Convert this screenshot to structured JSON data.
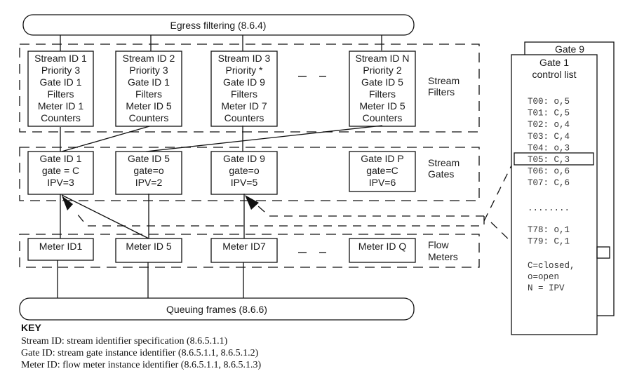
{
  "diagram": {
    "egress": {
      "label": "Egress filtering (8.6.4)"
    },
    "queuing": {
      "label": "Queuing frames (8.6.6)"
    },
    "groups": {
      "stream_filters": {
        "line1": "Stream",
        "line2": "Filters"
      },
      "stream_gates": {
        "line1": "Stream",
        "line2": "Gates"
      },
      "flow_meters": {
        "line1": "Flow",
        "line2": "Meters"
      }
    },
    "stream_filters": [
      {
        "lines": [
          "Stream ID 1",
          "Priority 3",
          "Gate ID 1",
          "Filters",
          "Meter ID 1",
          "Counters"
        ]
      },
      {
        "lines": [
          "Stream ID 2",
          "Priority 3",
          "Gate ID 1",
          "Filters",
          "Meter ID 5",
          "Counters"
        ]
      },
      {
        "lines": [
          "Stream ID 3",
          "Priority *",
          "Gate ID 9",
          "Filters",
          "Meter ID 7",
          "Counters"
        ]
      },
      {
        "lines": [
          "Stream ID N",
          "Priority 2",
          "Gate ID 5",
          "Filters",
          "Meter ID 5",
          "Counters"
        ]
      }
    ],
    "stream_gates": [
      {
        "lines": [
          "Gate ID 1",
          "gate = C",
          "IPV=3"
        ]
      },
      {
        "lines": [
          "Gate ID 5",
          "gate=o",
          "IPV=2"
        ]
      },
      {
        "lines": [
          "Gate ID 9",
          "gate=o",
          "IPV=5"
        ]
      },
      {
        "lines": [
          "Gate ID P",
          "gate=C",
          "IPV=6"
        ]
      }
    ],
    "flow_meters": [
      {
        "label": "Meter ID1"
      },
      {
        "label": "Meter ID 5"
      },
      {
        "label": "Meter ID7"
      },
      {
        "label": "Meter ID Q"
      }
    ],
    "control_list": {
      "back_title": "Gate 9",
      "title_line1": "Gate 1",
      "title_line2": "control list",
      "entries": [
        "T00: o,5",
        "T01: C,5",
        "T02: o,4",
        "T03: C,4",
        "T04: o,3",
        "T05: C,3",
        "T06: o,6",
        "T07: C,6"
      ],
      "ellipsis": "........",
      "tail_entries": [
        "T78: o,1",
        "T79: C,1"
      ],
      "highlighted_entry": "T05: C,3",
      "legend": [
        "C=closed,",
        "o=open",
        "N = IPV"
      ]
    },
    "key": {
      "title": "KEY",
      "lines": [
        "Stream ID: stream identifier specification (8.6.5.1.1)",
        "Gate ID: stream gate instance identifier (8.6.5.1.1, 8.6.5.1.2)",
        "Meter ID: flow meter instance identifier (8.6.5.1.1, 8.6.5.1.3)"
      ]
    }
  }
}
